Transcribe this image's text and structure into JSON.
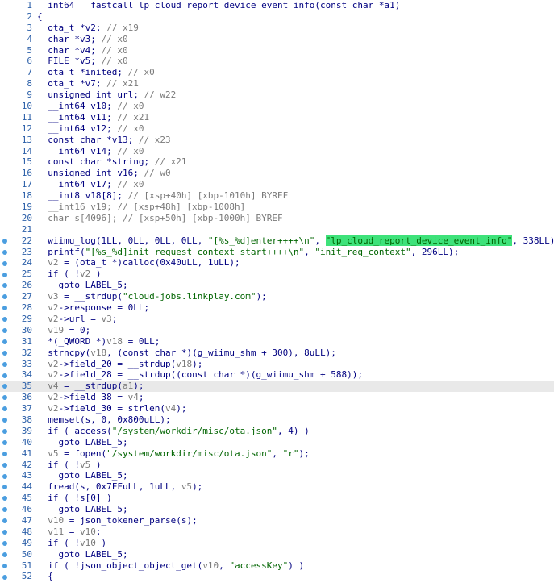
{
  "colors": {
    "keyword": "#000080",
    "comment": "#7a7a7a",
    "string": "#006400",
    "line_number": "#2b5fa8",
    "breakpoint_dot": "#4b9ee0",
    "current_line_bg": "#e9e9e9",
    "highlight": "#3ee27a"
  },
  "lines": [
    {
      "n": "1",
      "dot": false,
      "cur": false,
      "segs": [
        [
          "plain",
          "__int64 __fastcall lp_cloud_report_device_event_info(const char *a1)"
        ]
      ]
    },
    {
      "n": "2",
      "dot": false,
      "cur": false,
      "segs": [
        [
          "plain",
          "{"
        ]
      ]
    },
    {
      "n": "3",
      "dot": false,
      "cur": false,
      "segs": [
        [
          "plain",
          "  ota_t *v2; "
        ],
        [
          "cmt",
          "// x19"
        ]
      ]
    },
    {
      "n": "4",
      "dot": false,
      "cur": false,
      "segs": [
        [
          "plain",
          "  char *v3; "
        ],
        [
          "cmt",
          "// x0"
        ]
      ]
    },
    {
      "n": "5",
      "dot": false,
      "cur": false,
      "segs": [
        [
          "plain",
          "  char *v4; "
        ],
        [
          "cmt",
          "// x0"
        ]
      ]
    },
    {
      "n": "6",
      "dot": false,
      "cur": false,
      "segs": [
        [
          "plain",
          "  FILE *v5; "
        ],
        [
          "cmt",
          "// x0"
        ]
      ]
    },
    {
      "n": "7",
      "dot": false,
      "cur": false,
      "segs": [
        [
          "plain",
          "  ota_t *inited; "
        ],
        [
          "cmt",
          "// x0"
        ]
      ]
    },
    {
      "n": "8",
      "dot": false,
      "cur": false,
      "segs": [
        [
          "plain",
          "  ota_t *v7; "
        ],
        [
          "cmt",
          "// x21"
        ]
      ]
    },
    {
      "n": "9",
      "dot": false,
      "cur": false,
      "segs": [
        [
          "plain",
          "  unsigned int url; "
        ],
        [
          "cmt",
          "// w22"
        ]
      ]
    },
    {
      "n": "10",
      "dot": false,
      "cur": false,
      "segs": [
        [
          "plain",
          "  __int64 v10; "
        ],
        [
          "cmt",
          "// x0"
        ]
      ]
    },
    {
      "n": "11",
      "dot": false,
      "cur": false,
      "segs": [
        [
          "plain",
          "  __int64 v11; "
        ],
        [
          "cmt",
          "// x21"
        ]
      ]
    },
    {
      "n": "12",
      "dot": false,
      "cur": false,
      "segs": [
        [
          "plain",
          "  __int64 v12; "
        ],
        [
          "cmt",
          "// x0"
        ]
      ]
    },
    {
      "n": "13",
      "dot": false,
      "cur": false,
      "segs": [
        [
          "plain",
          "  const char *v13; "
        ],
        [
          "cmt",
          "// x23"
        ]
      ]
    },
    {
      "n": "14",
      "dot": false,
      "cur": false,
      "segs": [
        [
          "plain",
          "  __int64 v14; "
        ],
        [
          "cmt",
          "// x0"
        ]
      ]
    },
    {
      "n": "15",
      "dot": false,
      "cur": false,
      "segs": [
        [
          "plain",
          "  const char *string; "
        ],
        [
          "cmt",
          "// x21"
        ]
      ]
    },
    {
      "n": "16",
      "dot": false,
      "cur": false,
      "segs": [
        [
          "plain",
          "  unsigned int v16; "
        ],
        [
          "cmt",
          "// w0"
        ]
      ]
    },
    {
      "n": "17",
      "dot": false,
      "cur": false,
      "segs": [
        [
          "plain",
          "  __int64 v17; "
        ],
        [
          "cmt",
          "// x0"
        ]
      ]
    },
    {
      "n": "18",
      "dot": false,
      "cur": false,
      "segs": [
        [
          "plain",
          "  __int8 v18[8]; "
        ],
        [
          "cmt",
          "// [xsp+40h] [xbp-1010h] BYREF"
        ]
      ]
    },
    {
      "n": "19",
      "dot": false,
      "cur": false,
      "segs": [
        [
          "cmt",
          "  __int16 v19; // [xsp+48h] [xbp-1008h]"
        ]
      ]
    },
    {
      "n": "20",
      "dot": false,
      "cur": false,
      "segs": [
        [
          "cmt",
          "  char s[4096]; // [xsp+50h] [xbp-1000h] BYREF"
        ]
      ]
    },
    {
      "n": "21",
      "dot": false,
      "cur": false,
      "segs": [
        [
          "plain",
          ""
        ]
      ]
    },
    {
      "n": "22",
      "dot": true,
      "cur": false,
      "segs": [
        [
          "plain",
          "  wiimu_log(1LL, 0LL, 0LL, 0LL, "
        ],
        [
          "str",
          "\"[%s_%d]enter++++\\n\""
        ],
        [
          "plain",
          ", "
        ],
        [
          "hl",
          "\"lp_cloud_report_device_event_info\""
        ],
        [
          "plain",
          ", 338LL);"
        ]
      ]
    },
    {
      "n": "23",
      "dot": true,
      "cur": false,
      "segs": [
        [
          "plain",
          "  printf("
        ],
        [
          "str",
          "\"[%s_%d]init request context start++++\\n\""
        ],
        [
          "plain",
          ", "
        ],
        [
          "str",
          "\"init_req_context\""
        ],
        [
          "plain",
          ", 296LL);"
        ]
      ]
    },
    {
      "n": "24",
      "dot": true,
      "cur": false,
      "segs": [
        [
          "plain",
          "  "
        ],
        [
          "reg",
          "v2"
        ],
        [
          "plain",
          " = (ota_t *)calloc(0x40uLL, 1uLL);"
        ]
      ]
    },
    {
      "n": "25",
      "dot": true,
      "cur": false,
      "segs": [
        [
          "plain",
          "  if ( !"
        ],
        [
          "reg",
          "v2"
        ],
        [
          "plain",
          " )"
        ]
      ]
    },
    {
      "n": "26",
      "dot": true,
      "cur": false,
      "segs": [
        [
          "plain",
          "    goto LABEL_5;"
        ]
      ]
    },
    {
      "n": "27",
      "dot": true,
      "cur": false,
      "segs": [
        [
          "plain",
          "  "
        ],
        [
          "reg",
          "v3"
        ],
        [
          "plain",
          " = __strdup("
        ],
        [
          "str",
          "\"cloud-jobs.linkplay.com\""
        ],
        [
          "plain",
          ");"
        ]
      ]
    },
    {
      "n": "28",
      "dot": true,
      "cur": false,
      "segs": [
        [
          "plain",
          "  "
        ],
        [
          "reg",
          "v2"
        ],
        [
          "plain",
          "->response = 0LL;"
        ]
      ]
    },
    {
      "n": "29",
      "dot": true,
      "cur": false,
      "segs": [
        [
          "plain",
          "  "
        ],
        [
          "reg",
          "v2"
        ],
        [
          "plain",
          "->url = "
        ],
        [
          "reg",
          "v3"
        ],
        [
          "plain",
          ";"
        ]
      ]
    },
    {
      "n": "30",
      "dot": true,
      "cur": false,
      "segs": [
        [
          "plain",
          "  "
        ],
        [
          "reg",
          "v19"
        ],
        [
          "plain",
          " = 0;"
        ]
      ]
    },
    {
      "n": "31",
      "dot": true,
      "cur": false,
      "segs": [
        [
          "plain",
          "  *(_QWORD *)"
        ],
        [
          "reg",
          "v18"
        ],
        [
          "plain",
          " = 0LL;"
        ]
      ]
    },
    {
      "n": "32",
      "dot": true,
      "cur": false,
      "segs": [
        [
          "plain",
          "  strncpy("
        ],
        [
          "reg",
          "v18"
        ],
        [
          "plain",
          ", (const char *)(g_wiimu_shm + 300), 8uLL);"
        ]
      ]
    },
    {
      "n": "33",
      "dot": true,
      "cur": false,
      "segs": [
        [
          "plain",
          "  "
        ],
        [
          "reg",
          "v2"
        ],
        [
          "plain",
          "->field_20 = __strdup("
        ],
        [
          "reg",
          "v18"
        ],
        [
          "plain",
          ");"
        ]
      ]
    },
    {
      "n": "34",
      "dot": true,
      "cur": false,
      "segs": [
        [
          "plain",
          "  "
        ],
        [
          "reg",
          "v2"
        ],
        [
          "plain",
          "->field_28 = __strdup((const char *)(g_wiimu_shm + 588));"
        ]
      ]
    },
    {
      "n": "35",
      "dot": true,
      "cur": true,
      "segs": [
        [
          "plain",
          "  "
        ],
        [
          "reg",
          "v4"
        ],
        [
          "plain",
          " = __strdup("
        ],
        [
          "reg",
          "a1"
        ],
        [
          "plain",
          ");"
        ]
      ]
    },
    {
      "n": "36",
      "dot": true,
      "cur": false,
      "segs": [
        [
          "plain",
          "  "
        ],
        [
          "reg",
          "v2"
        ],
        [
          "plain",
          "->field_38 = "
        ],
        [
          "reg",
          "v4"
        ],
        [
          "plain",
          ";"
        ]
      ]
    },
    {
      "n": "37",
      "dot": true,
      "cur": false,
      "segs": [
        [
          "plain",
          "  "
        ],
        [
          "reg",
          "v2"
        ],
        [
          "plain",
          "->field_30 = strlen("
        ],
        [
          "reg",
          "v4"
        ],
        [
          "plain",
          ");"
        ]
      ]
    },
    {
      "n": "38",
      "dot": true,
      "cur": false,
      "segs": [
        [
          "plain",
          "  memset(s, 0, 0x800uLL);"
        ]
      ]
    },
    {
      "n": "39",
      "dot": true,
      "cur": false,
      "segs": [
        [
          "plain",
          "  if ( access("
        ],
        [
          "str",
          "\"/system/workdir/misc/ota.json\""
        ],
        [
          "plain",
          ", 4) )"
        ]
      ]
    },
    {
      "n": "40",
      "dot": true,
      "cur": false,
      "segs": [
        [
          "plain",
          "    goto LABEL_5;"
        ]
      ]
    },
    {
      "n": "41",
      "dot": true,
      "cur": false,
      "segs": [
        [
          "plain",
          "  "
        ],
        [
          "reg",
          "v5"
        ],
        [
          "plain",
          " = fopen("
        ],
        [
          "str",
          "\"/system/workdir/misc/ota.json\""
        ],
        [
          "plain",
          ", "
        ],
        [
          "str",
          "\"r\""
        ],
        [
          "plain",
          ");"
        ]
      ]
    },
    {
      "n": "42",
      "dot": true,
      "cur": false,
      "segs": [
        [
          "plain",
          "  if ( !"
        ],
        [
          "reg",
          "v5"
        ],
        [
          "plain",
          " )"
        ]
      ]
    },
    {
      "n": "43",
      "dot": true,
      "cur": false,
      "segs": [
        [
          "plain",
          "    goto LABEL_5;"
        ]
      ]
    },
    {
      "n": "44",
      "dot": true,
      "cur": false,
      "segs": [
        [
          "plain",
          "  fread(s, 0x7FFuLL, 1uLL, "
        ],
        [
          "reg",
          "v5"
        ],
        [
          "plain",
          ");"
        ]
      ]
    },
    {
      "n": "45",
      "dot": true,
      "cur": false,
      "segs": [
        [
          "plain",
          "  if ( !s[0] )"
        ]
      ]
    },
    {
      "n": "46",
      "dot": true,
      "cur": false,
      "segs": [
        [
          "plain",
          "    goto LABEL_5;"
        ]
      ]
    },
    {
      "n": "47",
      "dot": true,
      "cur": false,
      "segs": [
        [
          "plain",
          "  "
        ],
        [
          "reg",
          "v10"
        ],
        [
          "plain",
          " = json_tokener_parse(s);"
        ]
      ]
    },
    {
      "n": "48",
      "dot": true,
      "cur": false,
      "segs": [
        [
          "plain",
          "  "
        ],
        [
          "reg",
          "v11"
        ],
        [
          "plain",
          " = "
        ],
        [
          "reg",
          "v10"
        ],
        [
          "plain",
          ";"
        ]
      ]
    },
    {
      "n": "49",
      "dot": true,
      "cur": false,
      "segs": [
        [
          "plain",
          "  if ( !"
        ],
        [
          "reg",
          "v10"
        ],
        [
          "plain",
          " )"
        ]
      ]
    },
    {
      "n": "50",
      "dot": true,
      "cur": false,
      "segs": [
        [
          "plain",
          "    goto LABEL_5;"
        ]
      ]
    },
    {
      "n": "51",
      "dot": true,
      "cur": false,
      "segs": [
        [
          "plain",
          "  if ( !json_object_object_get("
        ],
        [
          "reg",
          "v10"
        ],
        [
          "plain",
          ", "
        ],
        [
          "str",
          "\"accessKey\""
        ],
        [
          "plain",
          ") )"
        ]
      ]
    },
    {
      "n": "52",
      "dot": true,
      "cur": false,
      "segs": [
        [
          "plain",
          "  {"
        ]
      ]
    }
  ]
}
